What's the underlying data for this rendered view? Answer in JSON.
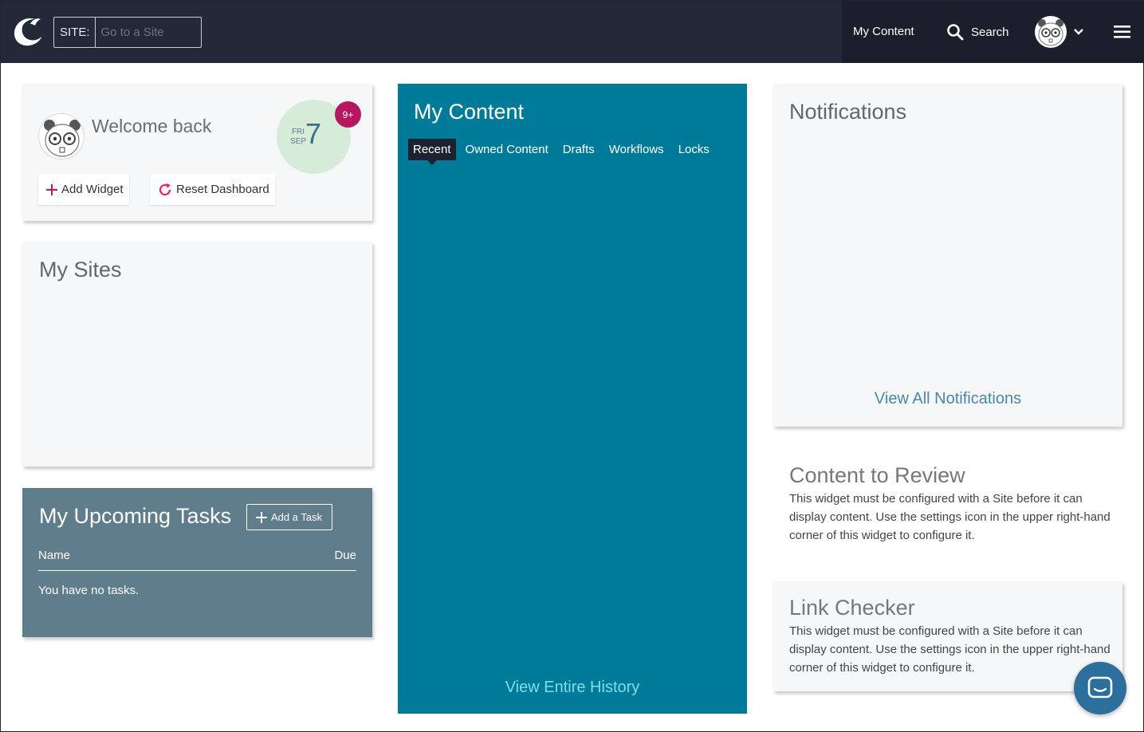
{
  "header": {
    "site_label": "SITE:",
    "site_placeholder": "Go to a Site",
    "nav_my_content": "My Content",
    "nav_search": "Search"
  },
  "welcome": {
    "text": "Welcome back",
    "date_dow": "FRI",
    "date_month": "SEP",
    "date_day": "7",
    "badge": "9+",
    "add_widget": "Add Widget",
    "reset_dashboard": "Reset Dashboard"
  },
  "my_sites": {
    "title": "My Sites"
  },
  "tasks": {
    "title": "My Upcoming Tasks",
    "add_task": "Add a Task",
    "col_name": "Name",
    "col_due": "Due",
    "empty": "You have no tasks."
  },
  "my_content": {
    "title": "My Content",
    "tabs": [
      "Recent",
      "Owned Content",
      "Drafts",
      "Workflows",
      "Locks"
    ],
    "active_tab": "Recent",
    "footer_link": "View Entire History"
  },
  "notifications": {
    "title": "Notifications",
    "footer_link": "View All Notifications"
  },
  "content_review": {
    "title": "Content to Review",
    "text": "This widget must be configured with a Site before it can display content. Use the settings icon in the upper right-hand corner of this widget to configure it."
  },
  "link_checker": {
    "title": "Link Checker",
    "text": "This widget must be configured with a Site before it can display content. Use the settings icon in the upper right-hand corner of this widget to configure it."
  },
  "colors": {
    "topbar": "#232938",
    "accent_teal": "#007a99",
    "tasks_bg": "#607d8b",
    "badge": "#b5185c",
    "date_bg": "#d6ecd9"
  },
  "icons": [
    "logo-icon",
    "search-icon",
    "avatar",
    "chevron-down-icon",
    "hamburger-menu-icon",
    "plus-icon",
    "refresh-icon",
    "chat-icon"
  ]
}
